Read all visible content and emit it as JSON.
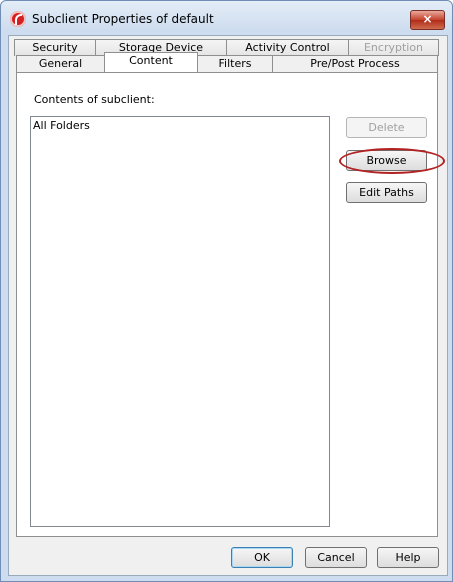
{
  "window": {
    "title": "Subclient Properties of default",
    "close_glyph": "×"
  },
  "tabs": {
    "row1": [
      {
        "label": "Security",
        "enabled": true
      },
      {
        "label": "Storage Device",
        "enabled": true
      },
      {
        "label": "Activity Control",
        "enabled": true
      },
      {
        "label": "Encryption",
        "enabled": false
      }
    ],
    "row2": [
      {
        "label": "General",
        "active": false
      },
      {
        "label": "Content",
        "active": true
      },
      {
        "label": "Filters",
        "active": false
      },
      {
        "label": "Pre/Post Process",
        "active": false
      }
    ]
  },
  "content": {
    "contents_label": "Contents of subclient:",
    "items": [
      "All Folders"
    ],
    "delete_label": "Delete",
    "browse_label": "Browse",
    "edit_paths_label": "Edit Paths"
  },
  "footer": {
    "ok_label": "OK",
    "cancel_label": "Cancel",
    "help_label": "Help"
  },
  "colors": {
    "highlight_ring": "#b22222",
    "app_icon": "#d42020"
  },
  "icons": {
    "app": "app-logo-icon",
    "close": "close-icon"
  }
}
